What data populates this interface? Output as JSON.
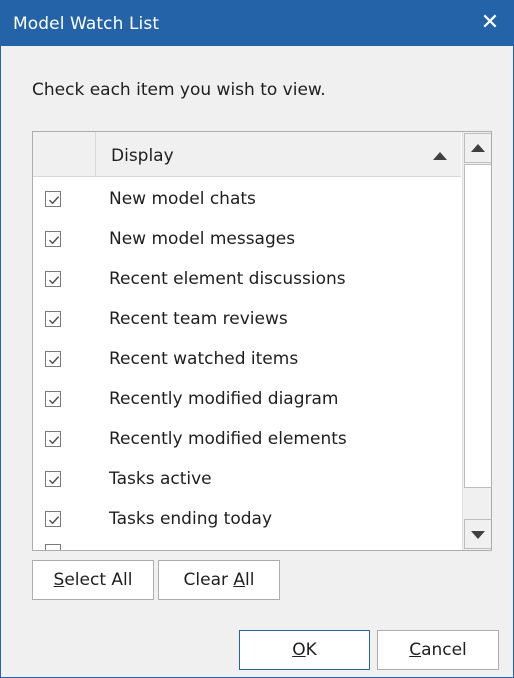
{
  "window": {
    "title": "Model Watch List",
    "close_glyph": "✕"
  },
  "instruction": "Check each item you wish to view.",
  "list": {
    "column_header": "Display",
    "sort": "ascending",
    "items": [
      {
        "label": "New model chats",
        "checked": true
      },
      {
        "label": "New model messages",
        "checked": true
      },
      {
        "label": "Recent element discussions",
        "checked": true
      },
      {
        "label": "Recent team reviews",
        "checked": true
      },
      {
        "label": "Recent watched items",
        "checked": true
      },
      {
        "label": "Recently modified diagram",
        "checked": true
      },
      {
        "label": "Recently modified elements",
        "checked": true
      },
      {
        "label": "Tasks active",
        "checked": true
      },
      {
        "label": "Tasks ending today",
        "checked": true
      }
    ]
  },
  "buttons": {
    "select_all": {
      "mnemonic": "S",
      "rest": "elect All"
    },
    "clear_all": {
      "prefix": "Clear ",
      "mnemonic": "A",
      "rest": "ll"
    },
    "ok": {
      "mnemonic": "O",
      "rest": "K"
    },
    "cancel": {
      "mnemonic": "C",
      "rest": "ancel"
    }
  },
  "colors": {
    "titlebar": "#2563a9",
    "check_mark": "#4a4a4a"
  }
}
